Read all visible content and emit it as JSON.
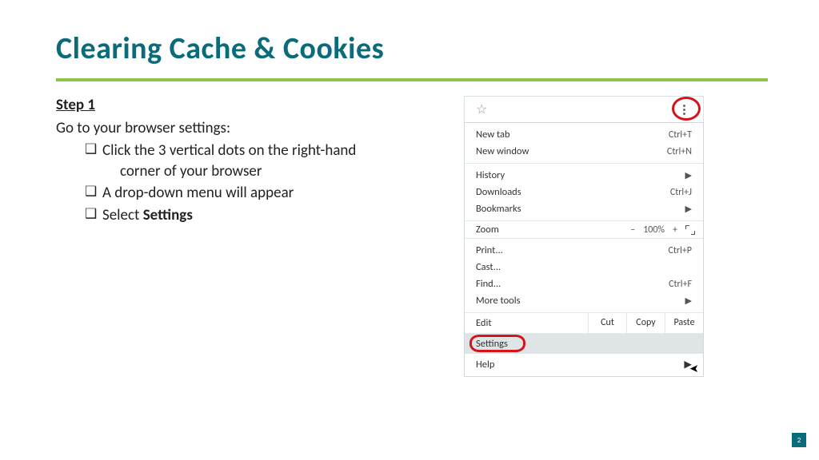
{
  "title": "Clearing Cache & Cookies",
  "step": {
    "label": "Step 1",
    "intro": "Go to your browser settings:"
  },
  "bullets": {
    "b1a": "Click the 3 vertical dots on the right-hand",
    "b1b": "corner of your browser",
    "b2": "A drop-down menu will appear",
    "b3a": "Select ",
    "b3b": "Settings"
  },
  "menu": {
    "newTab": {
      "label": "New tab",
      "shortcut": "Ctrl+T"
    },
    "newWindow": {
      "label": "New window",
      "shortcut": "Ctrl+N"
    },
    "history": {
      "label": "History"
    },
    "downloads": {
      "label": "Downloads",
      "shortcut": "Ctrl+J"
    },
    "bookmarks": {
      "label": "Bookmarks"
    },
    "zoom": {
      "label": "Zoom",
      "minus": "–",
      "value": "100%",
      "plus": "+"
    },
    "print": {
      "label": "Print...",
      "shortcut": "Ctrl+P"
    },
    "cast": {
      "label": "Cast..."
    },
    "find": {
      "label": "Find...",
      "shortcut": "Ctrl+F"
    },
    "moreTools": {
      "label": "More tools"
    },
    "edit": {
      "label": "Edit",
      "cut": "Cut",
      "copy": "Copy",
      "paste": "Paste"
    },
    "settings": {
      "label": "Settings"
    },
    "help": {
      "label": "Help"
    }
  },
  "pageNumber": "2"
}
